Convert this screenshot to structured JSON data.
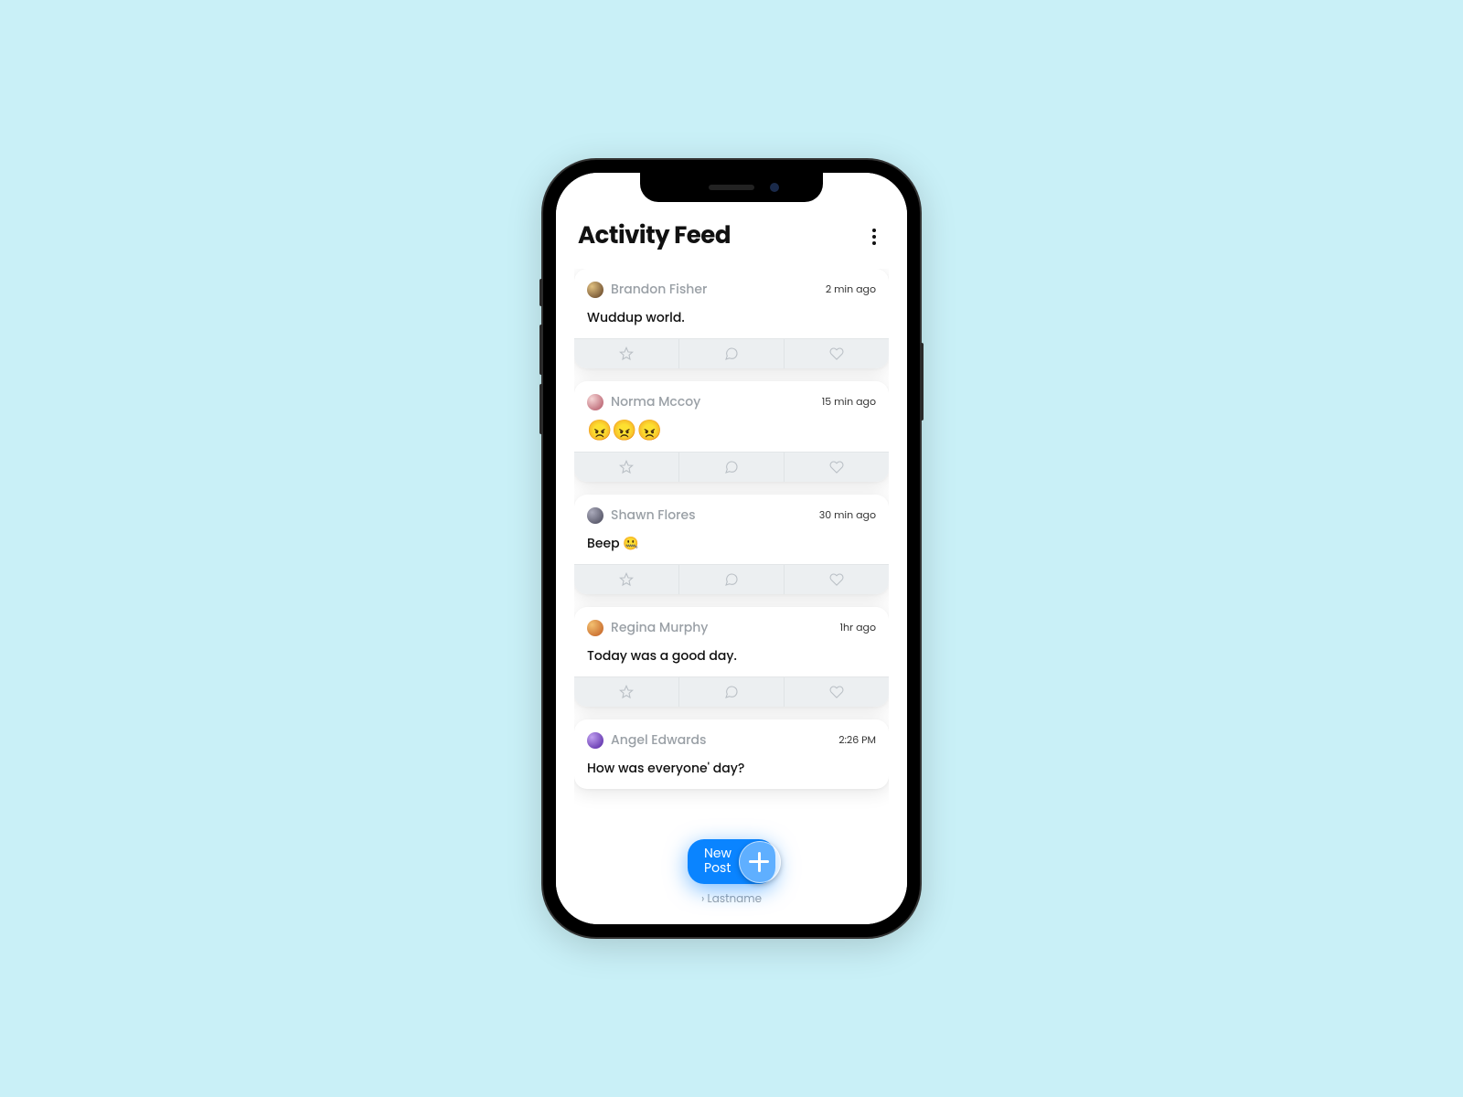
{
  "header": {
    "title": "Activity Feed"
  },
  "feed": [
    {
      "user": "Brandon Fisher",
      "time": "2 min ago",
      "content": "Wuddup world.",
      "avatar": "av1",
      "emoji": false
    },
    {
      "user": "Norma Mccoy",
      "time": "15 min ago",
      "content": "😠😠😠",
      "avatar": "av2",
      "emoji": true
    },
    {
      "user": "Shawn Flores",
      "time": "30 min ago",
      "content": "Beep 🤐",
      "avatar": "av3",
      "emoji": false
    },
    {
      "user": "Regina Murphy",
      "time": "1hr ago",
      "content": "Today was a good day.",
      "avatar": "av4",
      "emoji": false
    },
    {
      "user": "Angel Edwards",
      "time": "2:26 PM",
      "content": "How was everyone' day?",
      "avatar": "av5",
      "emoji": false
    }
  ],
  "icons": {
    "star": "star-icon",
    "comment": "comment-icon",
    "heart": "heart-icon"
  },
  "newpost": {
    "label_line1": "New",
    "label_line2": "Post"
  },
  "footer_hint": "› Lastname"
}
